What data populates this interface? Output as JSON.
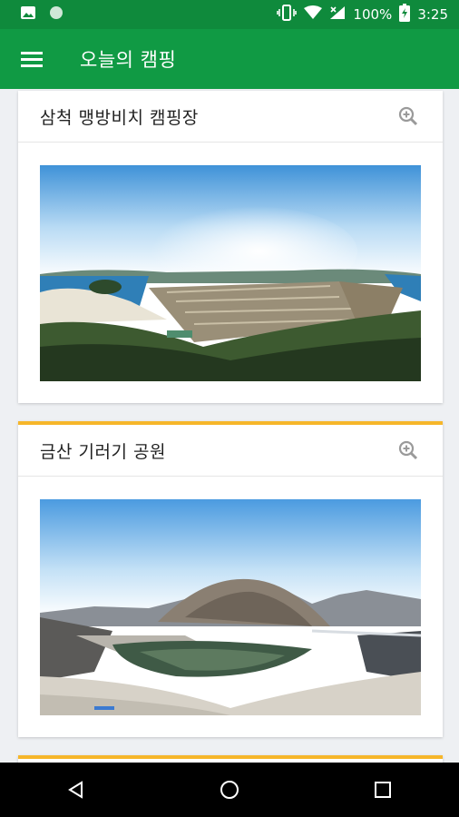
{
  "status_bar": {
    "battery_text": "100%",
    "time": "3:25",
    "icons": [
      "image-icon",
      "circle-icon",
      "vibrate-icon",
      "wifi-icon",
      "signal-icon",
      "battery-charging-icon"
    ]
  },
  "app_bar": {
    "title": "오늘의 캠핑",
    "menu_icon": "hamburger-menu-icon"
  },
  "cards": [
    {
      "title": "삼척 맹방비치 캠핑장",
      "action_icon": "zoom-in-icon",
      "image": "panorama-beach-campsite"
    },
    {
      "title": "금산 기러기 공원",
      "action_icon": "zoom-in-icon",
      "image": "panorama-mountain-river-park"
    }
  ],
  "nav_bar": {
    "buttons": [
      "back-icon",
      "home-icon",
      "recents-icon"
    ]
  },
  "colors": {
    "app_bar": "#109a44",
    "status_bar": "#0f8a3c",
    "card_accent": "#f6b62a"
  }
}
